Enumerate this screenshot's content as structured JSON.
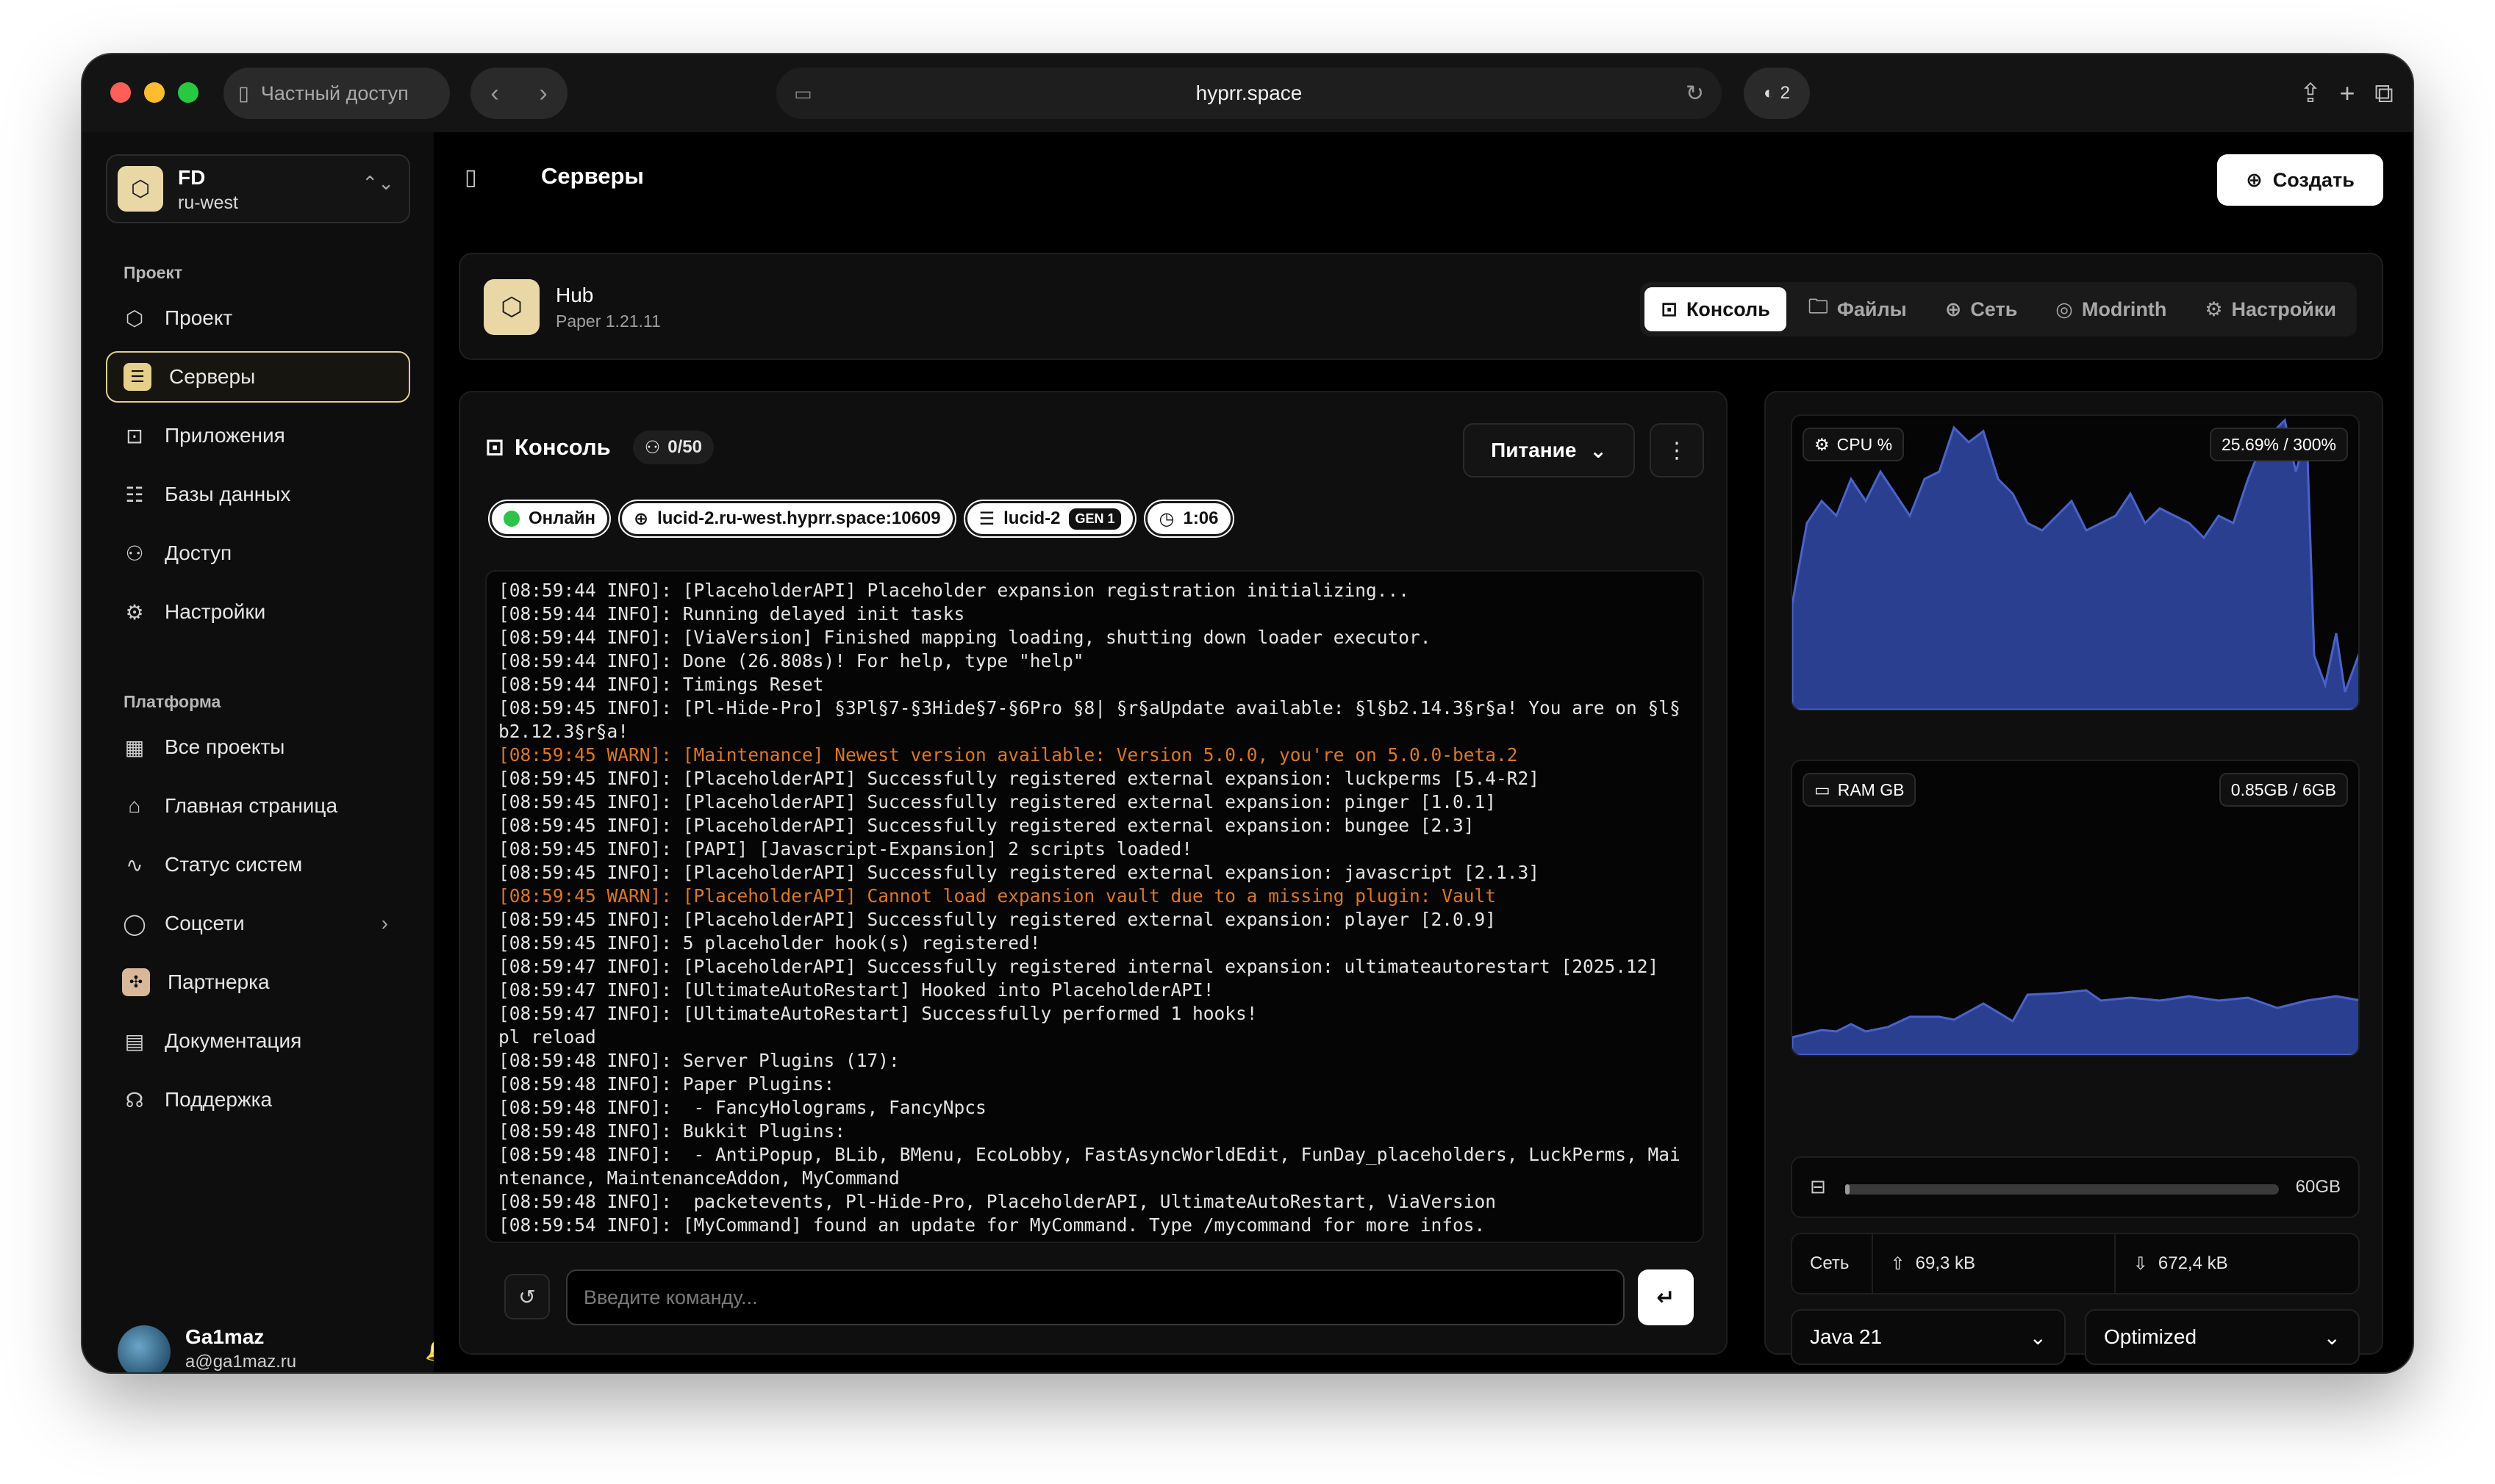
{
  "browser": {
    "private_label": "Частный доступ",
    "url": "hyprr.space",
    "shield_count": "2"
  },
  "org": {
    "initials": "FD",
    "region": "ru-west"
  },
  "sidebar": {
    "section_project": "Проект",
    "section_platform": "Платформа",
    "project_items": [
      {
        "label": "Проект",
        "icon": "cube-icon"
      },
      {
        "label": "Серверы",
        "icon": "server-icon",
        "active": true
      },
      {
        "label": "Приложения",
        "icon": "terminal-icon"
      },
      {
        "label": "Базы данных",
        "icon": "database-icon"
      },
      {
        "label": "Доступ",
        "icon": "users-icon"
      },
      {
        "label": "Настройки",
        "icon": "gear-icon"
      }
    ],
    "platform_items": [
      {
        "label": "Все проекты",
        "icon": "layout-icon"
      },
      {
        "label": "Главная страница",
        "icon": "home-icon"
      },
      {
        "label": "Статус систем",
        "icon": "activity-icon"
      },
      {
        "label": "Соцсети",
        "icon": "chat-icon"
      },
      {
        "label": "Партнерка",
        "icon": "partner-icon"
      },
      {
        "label": "Документация",
        "icon": "doc-icon"
      },
      {
        "label": "Поддержка",
        "icon": "headset-icon"
      }
    ]
  },
  "user": {
    "name": "Ga1maz",
    "email": "a@ga1maz.ru"
  },
  "header": {
    "title": "Серверы",
    "create_label": "Создать"
  },
  "server": {
    "name": "Hub",
    "version": "Paper 1.21.11",
    "tabs": [
      "Консоль",
      "Файлы",
      "Сеть",
      "Modrinth",
      "Настройки"
    ]
  },
  "console": {
    "title": "Консоль",
    "players": "0/50",
    "power_label": "Питание",
    "status": "Онлайн",
    "address": "lucid-2.ru-west.hyprr.space:10609",
    "node": "lucid-2",
    "node_gen": "GEN 1",
    "uptime": "1:06",
    "input_placeholder": "Введите команду...",
    "lines": [
      {
        "text": "[08:59:44 INFO]: [PlaceholderAPI] Placeholder expansion registration initializing..."
      },
      {
        "text": "[08:59:44 INFO]: Running delayed init tasks"
      },
      {
        "text": "[08:59:44 INFO]: [ViaVersion] Finished mapping loading, shutting down loader executor."
      },
      {
        "text": "[08:59:44 INFO]: Done (26.808s)! For help, type \"help\""
      },
      {
        "text": "[08:59:44 INFO]: Timings Reset"
      },
      {
        "text": "[08:59:45 INFO]: [Pl-Hide-Pro] §3Pl§7-§3Hide§7-§6Pro §8| §r§aUpdate available: §l§b2.14.3§r§a! You are on §l§"
      },
      {
        "text": "b2.12.3§r§a!"
      },
      {
        "text": "[08:59:45 WARN]: [Maintenance] Newest version available: Version 5.0.0, you're on 5.0.0-beta.2",
        "warn": true
      },
      {
        "text": "[08:59:45 INFO]: [PlaceholderAPI] Successfully registered external expansion: luckperms [5.4-R2]"
      },
      {
        "text": "[08:59:45 INFO]: [PlaceholderAPI] Successfully registered external expansion: pinger [1.0.1]"
      },
      {
        "text": "[08:59:45 INFO]: [PlaceholderAPI] Successfully registered external expansion: bungee [2.3]"
      },
      {
        "text": "[08:59:45 INFO]: [PAPI] [Javascript-Expansion] 2 scripts loaded!"
      },
      {
        "text": "[08:59:45 INFO]: [PlaceholderAPI] Successfully registered external expansion: javascript [2.1.3]"
      },
      {
        "text": "[08:59:45 WARN]: [PlaceholderAPI] Cannot load expansion vault due to a missing plugin: Vault",
        "warn": true
      },
      {
        "text": "[08:59:45 INFO]: [PlaceholderAPI] Successfully registered external expansion: player [2.0.9]"
      },
      {
        "text": "[08:59:45 INFO]: 5 placeholder hook(s) registered!"
      },
      {
        "text": "[08:59:47 INFO]: [PlaceholderAPI] Successfully registered internal expansion: ultimateautorestart [2025.12]"
      },
      {
        "text": "[08:59:47 INFO]: [UltimateAutoRestart] Hooked into PlaceholderAPI!"
      },
      {
        "text": "[08:59:47 INFO]: [UltimateAutoRestart] Successfully performed 1 hooks!"
      },
      {
        "text": "pl reload"
      },
      {
        "text": "[08:59:48 INFO]: Server Plugins (17):"
      },
      {
        "text": "[08:59:48 INFO]: Paper Plugins:"
      },
      {
        "text": "[08:59:48 INFO]:  - FancyHolograms, FancyNpcs"
      },
      {
        "text": "[08:59:48 INFO]: Bukkit Plugins:"
      },
      {
        "text": "[08:59:48 INFO]:  - AntiPopup, BLib, BMenu, EcoLobby, FastAsyncWorldEdit, FunDay_placeholders, LuckPerms, Mai"
      },
      {
        "text": "ntenance, MaintenanceAddon, MyCommand"
      },
      {
        "text": "[08:59:48 INFO]:  packetevents, Pl-Hide-Pro, PlaceholderAPI, UltimateAutoRestart, ViaVersion"
      },
      {
        "text": "[08:59:54 INFO]: [MyCommand] found an update for MyCommand. Type /mycommand for more infos."
      }
    ]
  },
  "stats": {
    "cpu_label": "CPU %",
    "cpu_value": "25.69% / 300%",
    "ram_label": "RAM GB",
    "ram_value": "0.85GB / 6GB",
    "disk_size": "60GB",
    "disk_fraction": 0.01,
    "net_label": "Сеть",
    "net_up": "69,3 kB",
    "net_down": "672,4 kB",
    "java_select": "Java 21",
    "profile_select": "Optimized",
    "accent": "#2a3f8f"
  }
}
